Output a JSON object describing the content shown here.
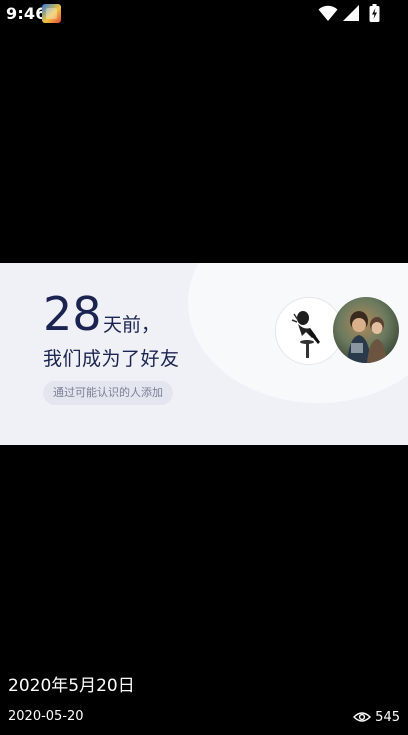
{
  "status_bar": {
    "time": "9:46"
  },
  "card": {
    "days_number": "28",
    "days_suffix": "天前，",
    "friend_line": "我们成为了好友",
    "source_chip": "通过可能认识的人添加"
  },
  "footer": {
    "title": "2020年5月20日",
    "date": "2020-05-20",
    "views": "545"
  },
  "colors": {
    "background": "#000000",
    "card_bg": "#f0f1f7",
    "card_text": "#1b2450",
    "chip_bg": "#e3e5ef",
    "chip_text": "#7a7f96"
  },
  "icons": [
    "app-notification-icon",
    "wifi-icon",
    "signal-icon",
    "battery-icon",
    "eye-icon"
  ]
}
